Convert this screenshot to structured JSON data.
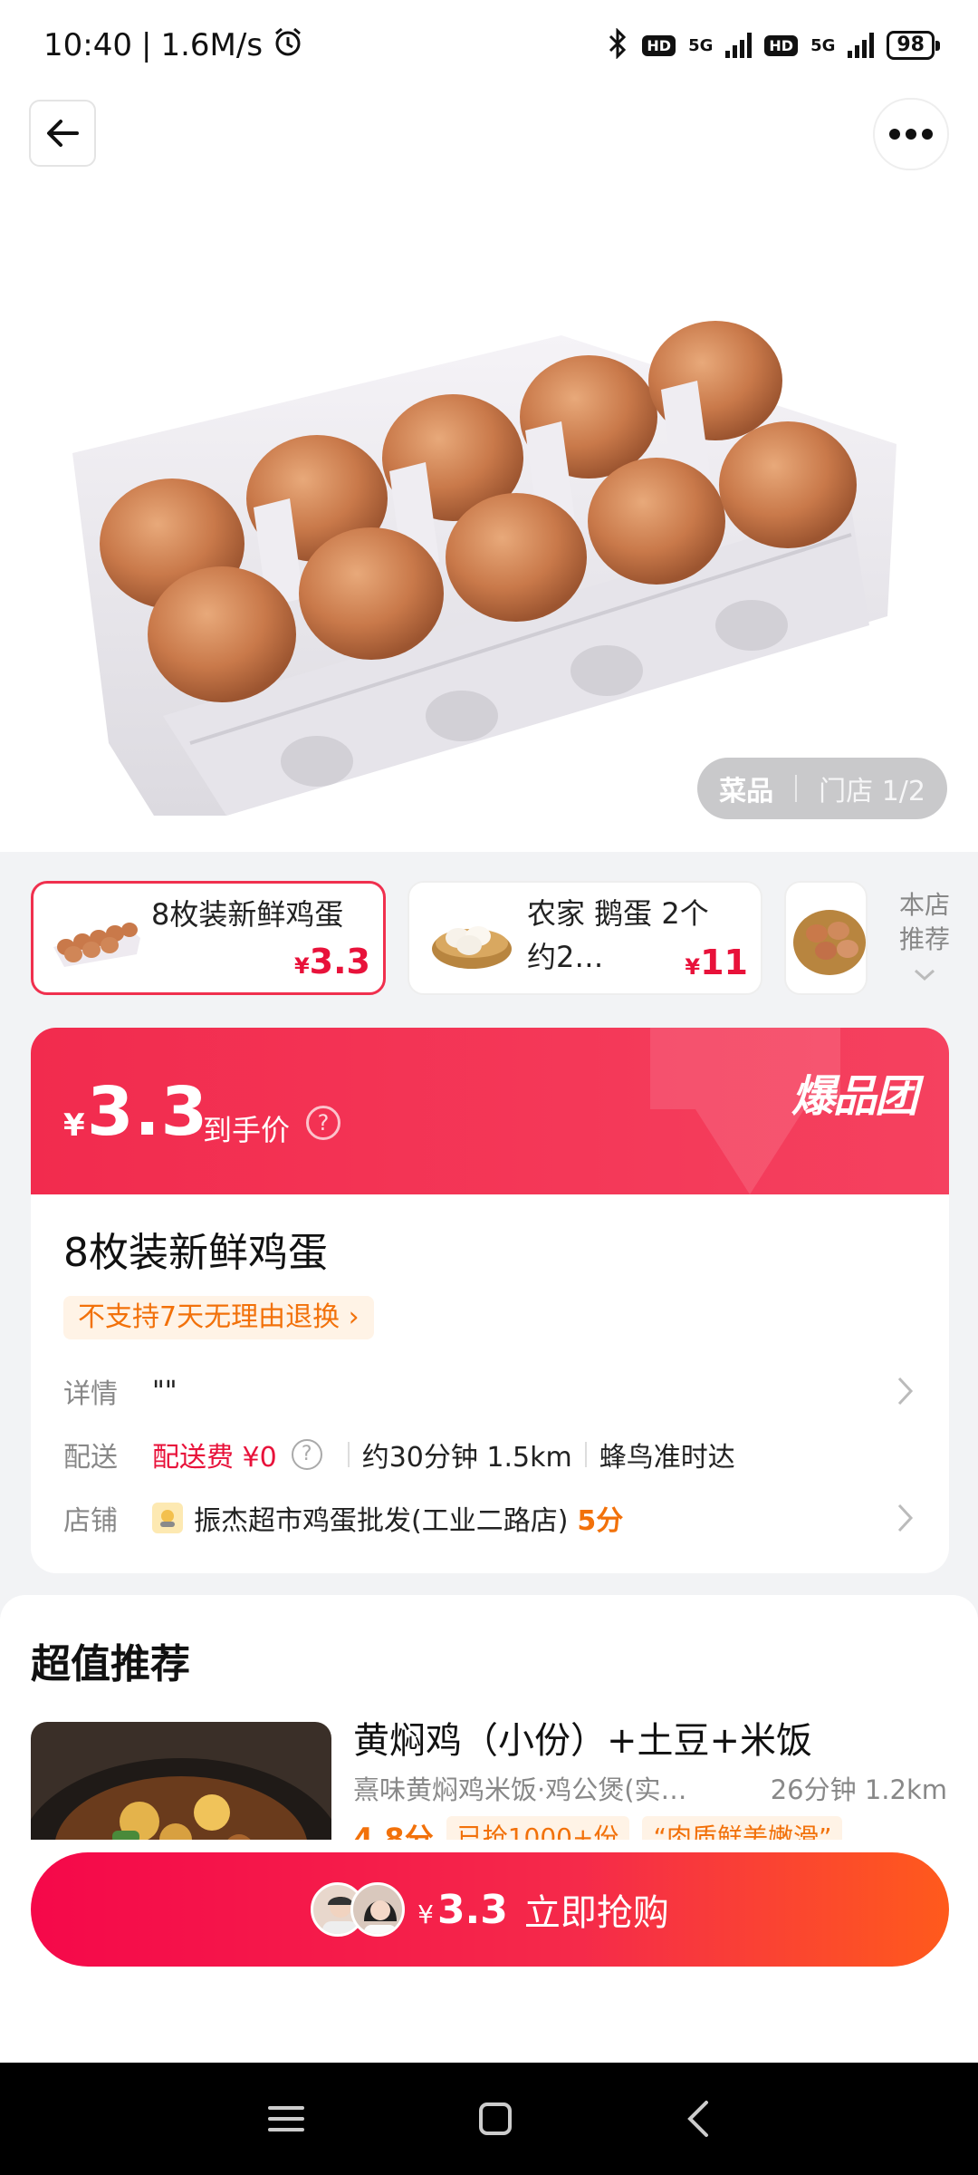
{
  "status_bar": {
    "time": "10:40",
    "speed": "1.6M/s",
    "hd1": "HD",
    "net1": "5G",
    "hd2": "HD",
    "net2": "5G",
    "battery": "98"
  },
  "gallery": {
    "tab_active": "菜品",
    "tab_store": "门店 1/2"
  },
  "variants": [
    {
      "name": "8枚装新鲜鸡蛋",
      "currency": "¥",
      "price": "3.3"
    },
    {
      "name": "农家 鹅蛋 2个 约2…",
      "currency": "¥",
      "price": "11"
    }
  ],
  "store_recommend": "本店推荐",
  "deal": {
    "currency": "¥",
    "price": "3.3",
    "price_tag": "到手价",
    "help": "?",
    "brand": "爆品团"
  },
  "product": {
    "title": "8枚装新鲜鸡蛋",
    "policy": "不支持7天无理由退换",
    "policy_arrow": "›"
  },
  "rows": {
    "detail_label": "详情",
    "detail_value": "\"\"",
    "delivery_label": "配送",
    "delivery_fee": "配送费 ¥0",
    "delivery_help": "?",
    "delivery_time": "约30分钟 1.5km",
    "delivery_service": "蜂鸟准时达",
    "shop_label": "店铺",
    "shop_name": "振杰超市鸡蛋批发(工业二路店)",
    "shop_score": "5分"
  },
  "recommend": {
    "title": "超值推荐",
    "item_name": "黄焖鸡（小份）+土豆+米饭",
    "item_shop": "熹味黄焖鸡米饭·鸡公煲(实…",
    "item_meta": "26分钟 1.2km",
    "item_score": "4.8分",
    "item_tag1": "已抢1000+份",
    "item_tag2": "“肉质鲜美嫩滑”"
  },
  "buy": {
    "currency": "¥",
    "price": "3.3",
    "label": "立即抢购"
  }
}
